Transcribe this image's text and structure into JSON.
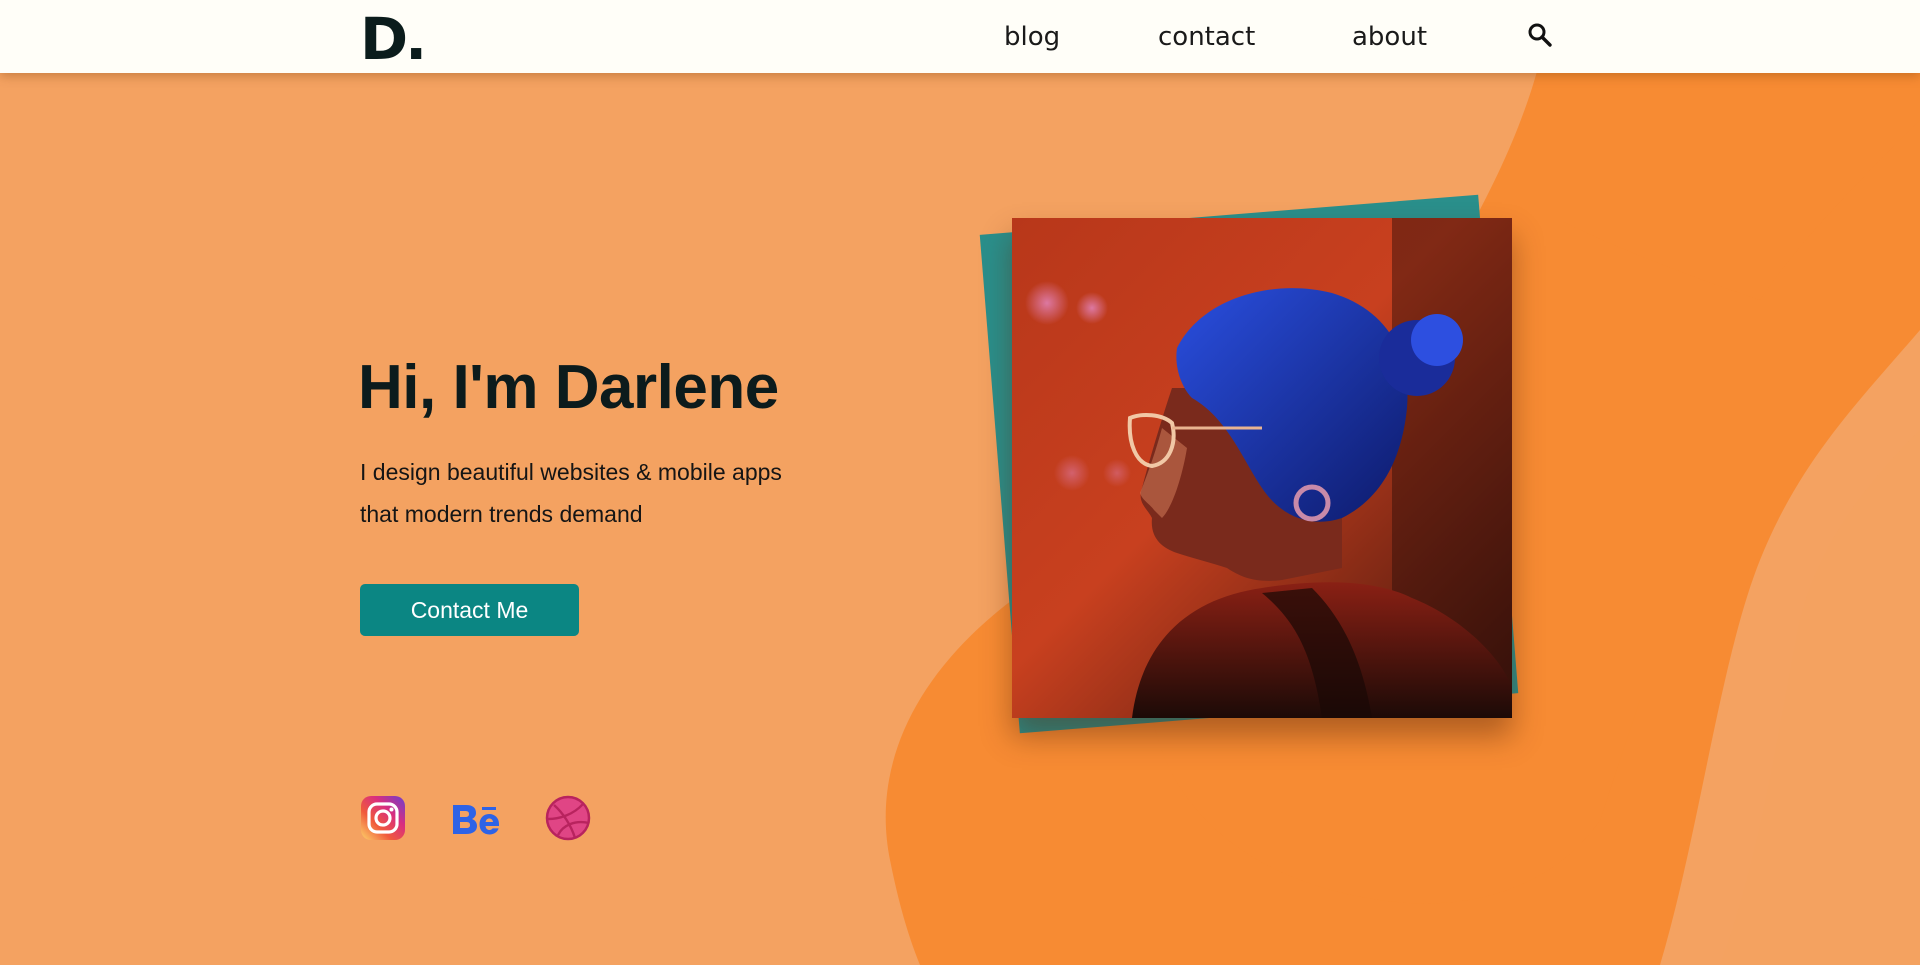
{
  "header": {
    "logo": "D.",
    "nav": [
      {
        "label": "blog"
      },
      {
        "label": "contact"
      },
      {
        "label": "about"
      }
    ],
    "search_icon": "search-icon"
  },
  "hero": {
    "title": "Hi, I'm Darlene",
    "subtitle": "I design beautiful websites & mobile apps that modern trends demand",
    "cta_label": "Contact Me",
    "photo": "portrait-photo"
  },
  "social": [
    {
      "icon": "instagram-icon"
    },
    {
      "icon": "behance-icon"
    },
    {
      "icon": "dribbble-icon"
    }
  ],
  "colors": {
    "background": "#f4a261",
    "blob": "#f78b33",
    "header_bg": "#fffef8",
    "accent": "#0b8683",
    "text_dark": "#0c1b1c"
  }
}
